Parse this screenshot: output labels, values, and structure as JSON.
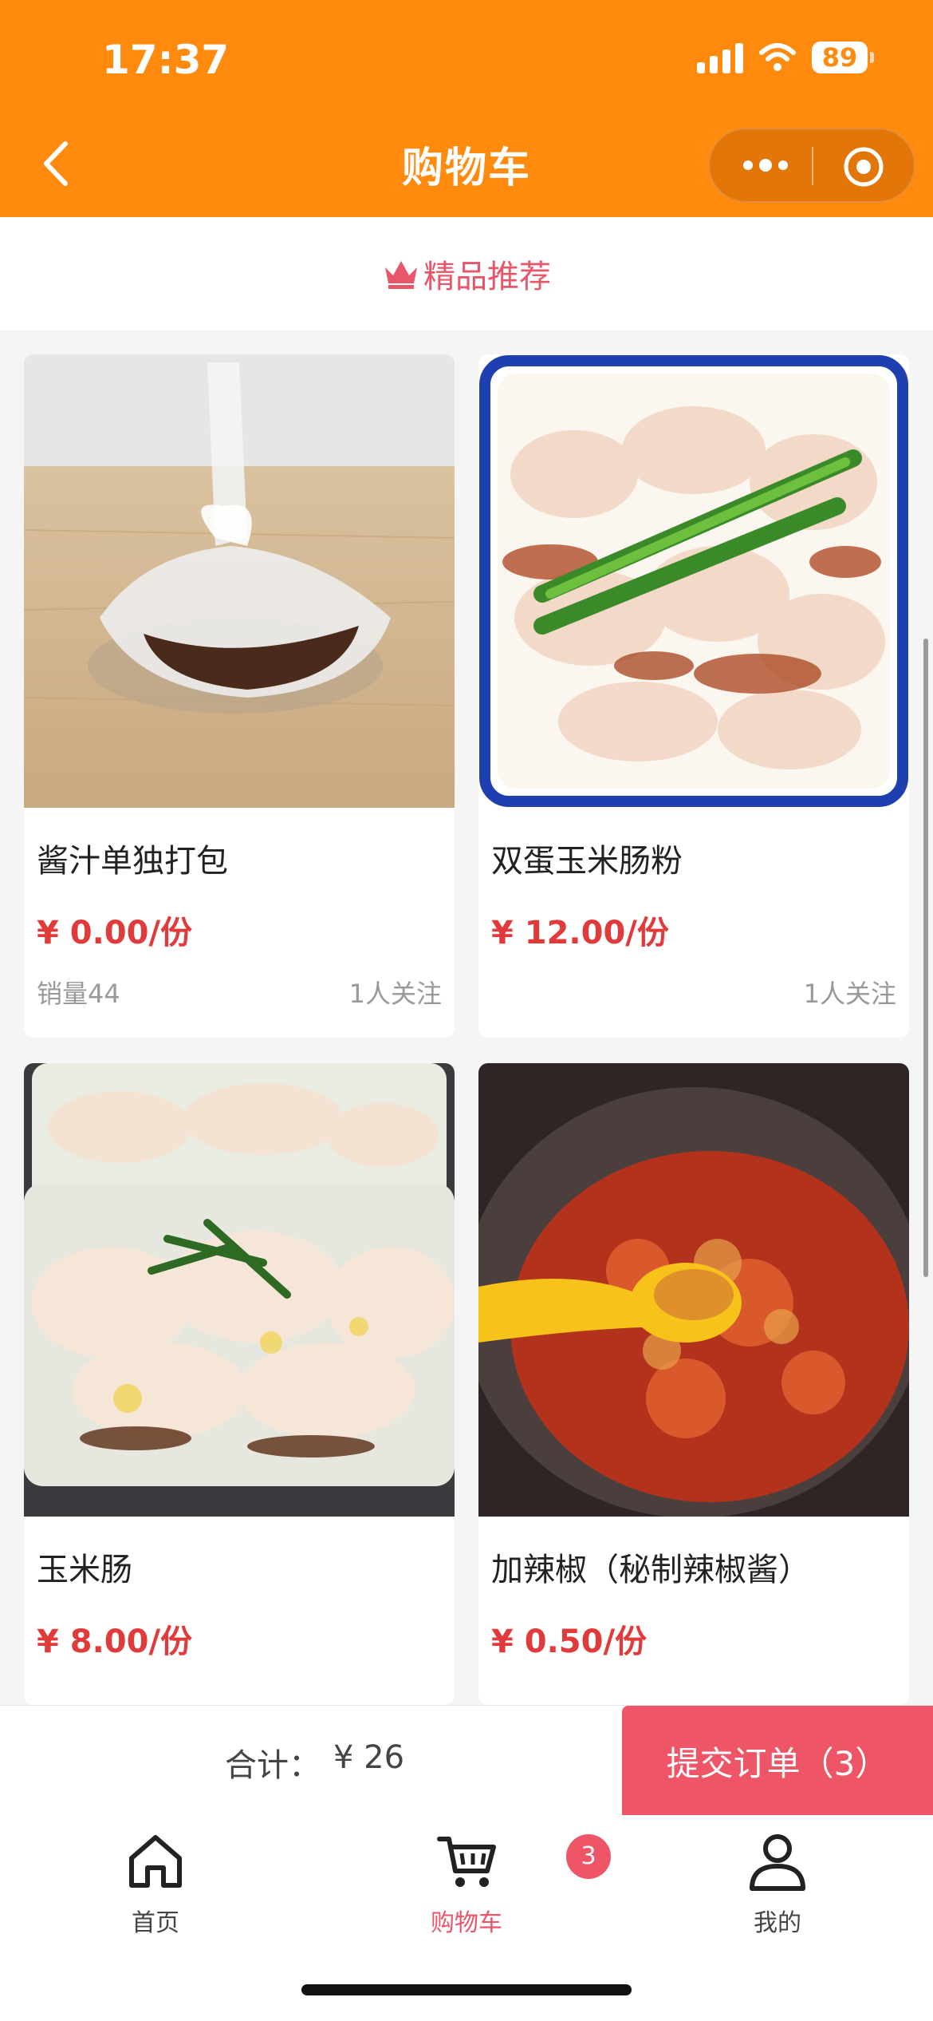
{
  "status_bar": {
    "time": "17:37",
    "battery": "89"
  },
  "header": {
    "title": "购物车"
  },
  "section": {
    "title": "精品推荐"
  },
  "products": [
    {
      "name": "酱汁单独打包",
      "price": "¥ 0.00/份",
      "sales": "销量44",
      "followers": "1人关注"
    },
    {
      "name": "双蛋玉米肠粉",
      "price": "¥ 12.00/份",
      "sales": "",
      "followers": "1人关注"
    },
    {
      "name": "玉米肠",
      "price": "¥ 8.00/份"
    },
    {
      "name": "加辣椒（秘制辣椒酱）",
      "price": "¥ 0.50/份"
    }
  ],
  "cart_summary": {
    "total_label": "合计：",
    "total_value": "¥ 26",
    "submit_label": "提交订单（3）"
  },
  "tabbar": {
    "items": [
      {
        "label": "首页",
        "icon": "home-icon"
      },
      {
        "label": "购物车",
        "icon": "cart-icon",
        "badge": "3"
      },
      {
        "label": "我的",
        "icon": "user-icon"
      }
    ]
  },
  "colors": {
    "header": "#ff8a0d",
    "accent": "#e8566a",
    "price": "#e03a3a",
    "submit": "#ee5566"
  }
}
